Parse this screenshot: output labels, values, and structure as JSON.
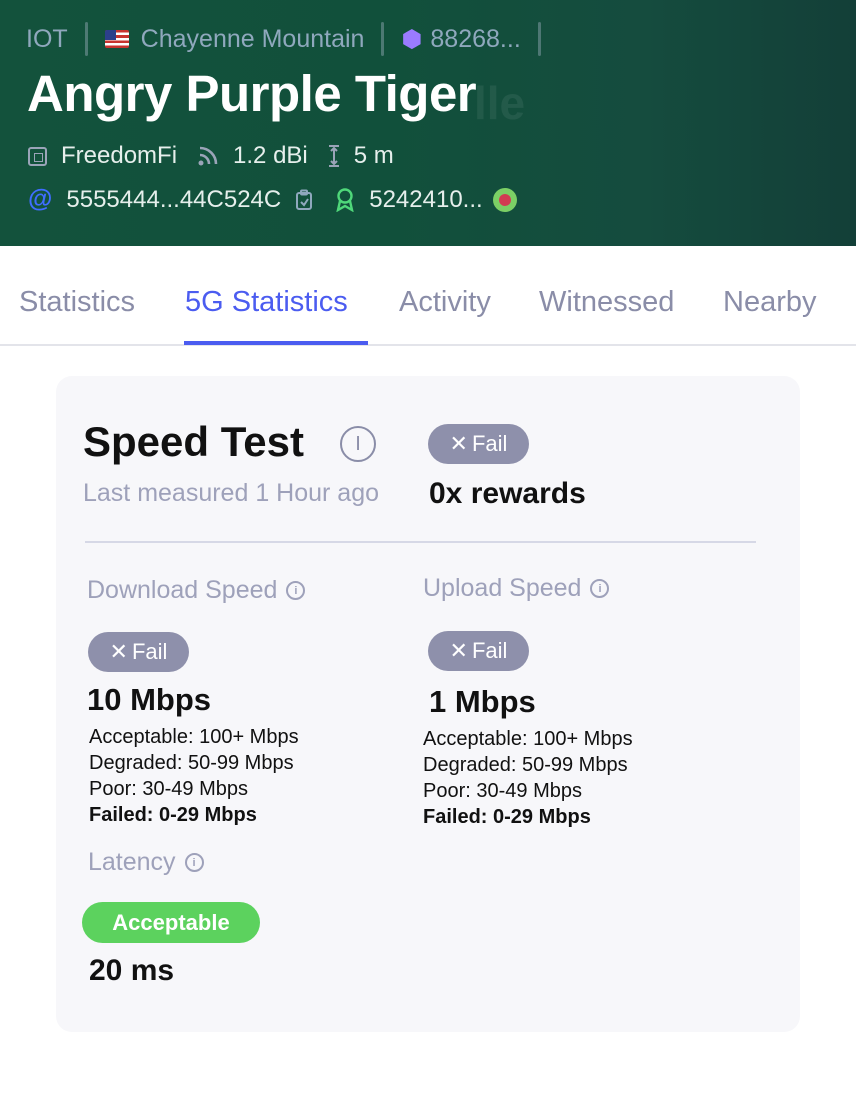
{
  "header": {
    "crumbs": {
      "network": "IOT",
      "location": "Chayenne Mountain",
      "hotspot_id": "88268..."
    },
    "flag_icon": "us-flag-icon",
    "title": "Angry Purple Tiger",
    "maker": "FreedomFi",
    "antenna_gain": "1.2 dBi",
    "elevation": "5 m",
    "address_start": "5555444...",
    "address_end": "44C524C",
    "owner": "5242410...",
    "colors": {
      "background": "#13523c",
      "accent": "#4b5cf0"
    }
  },
  "tabs": [
    {
      "label": "Statistics"
    },
    {
      "label": "5G Statistics"
    },
    {
      "label": "Activity"
    },
    {
      "label": "Witnessed"
    },
    {
      "label": "Nearby"
    }
  ],
  "active_tab": "5G Statistics",
  "speed_test": {
    "title": "Speed Test",
    "last_measured": "Last measured 1 Hour ago",
    "status_x": "✕",
    "status": "Fail",
    "rewards": "0x rewards",
    "download": {
      "label": "Download Speed",
      "status": "Fail",
      "value": "10 Mbps",
      "acceptable": "Acceptable: 100+ Mbps",
      "degraded": "Degraded: 50-99 Mbps",
      "poor": "Poor: 30-49 Mbps",
      "failed": "Failed: 0-29 Mbps"
    },
    "upload": {
      "label": "Upload Speed",
      "status": "Fail",
      "value": "1 Mbps",
      "acceptable": "Acceptable: 100+ Mbps",
      "degraded": "Degraded: 50-99 Mbps",
      "poor": "Poor: 30-49 Mbps",
      "failed": "Failed: 0-29 Mbps"
    },
    "latency": {
      "label": "Latency",
      "status": "Acceptable",
      "value": "20 ms"
    },
    "colors": {
      "fail": "#8e90ab",
      "acceptable": "#5cd25e"
    }
  }
}
